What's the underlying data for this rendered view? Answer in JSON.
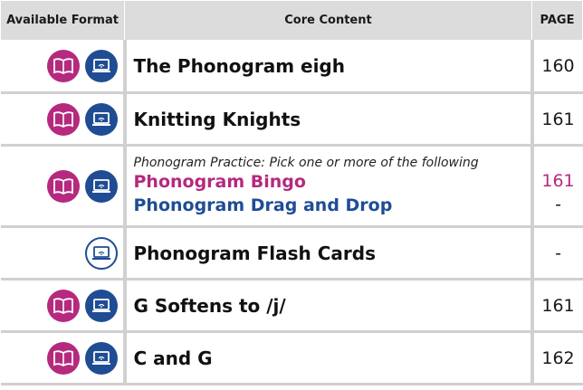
{
  "header": {
    "format": "Available Format",
    "content": "Core Content",
    "page": "PAGE"
  },
  "colors": {
    "book": "#b5297e",
    "digital": "#1f4d94",
    "header_bg": "#dcdcdc"
  },
  "rows": [
    {
      "formats": [
        "book-icon",
        "laptop-icon"
      ],
      "title": "The Phonogram eigh",
      "page": "160"
    },
    {
      "formats": [
        "book-icon",
        "laptop-icon"
      ],
      "title": "Knitting Knights",
      "page": "161"
    },
    {
      "formats": [
        "book-icon",
        "laptop-icon"
      ],
      "intro": "Phonogram Practice: Pick one or more of the following",
      "options": [
        {
          "label": "Phonogram Bingo",
          "page": "161"
        },
        {
          "label": "Phonogram Drag and Drop",
          "page": "-"
        }
      ]
    },
    {
      "formats": [
        "laptop-outline-icon"
      ],
      "title": "Phonogram Flash Cards",
      "page": "-"
    },
    {
      "formats": [
        "book-icon",
        "laptop-icon"
      ],
      "title": "G Softens to /j/",
      "page": "161"
    },
    {
      "formats": [
        "book-icon",
        "laptop-icon"
      ],
      "title": "C and G",
      "page": "162"
    }
  ]
}
